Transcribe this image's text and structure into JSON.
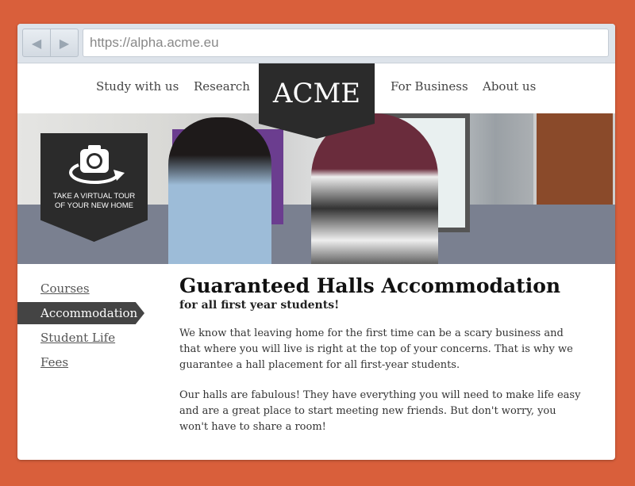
{
  "browser": {
    "url": "https://alpha.acme.eu",
    "back_icon": "◀",
    "forward_icon": "▶"
  },
  "nav": {
    "items": [
      "Study with us",
      "Research",
      "For Business",
      "About us"
    ],
    "logo": "ACME"
  },
  "badge": {
    "text": "TAKE A VIRTUAL TOUR OF YOUR NEW HOME",
    "icon": "camera-360-icon"
  },
  "sidebar": {
    "items": [
      {
        "label": "Courses"
      },
      {
        "label": "Accommodation",
        "active": true
      },
      {
        "label": "Student Life"
      },
      {
        "label": "Fees"
      }
    ]
  },
  "main": {
    "title": "Guaranteed Halls Accommodation",
    "subtitle": "for all first year students!",
    "paragraphs": [
      "We know that leaving home for the first time can be a scary business and that where you will live is right at the top of your concerns. That is why we guarantee a hall placement for all first-year students.",
      "Our halls are fabulous! They have everything you will need to make life easy and are a great place to start meeting new friends. But don't worry, you won't have to share a room!"
    ]
  },
  "colors": {
    "background": "#d95f3b",
    "dark": "#2b2b2b"
  }
}
